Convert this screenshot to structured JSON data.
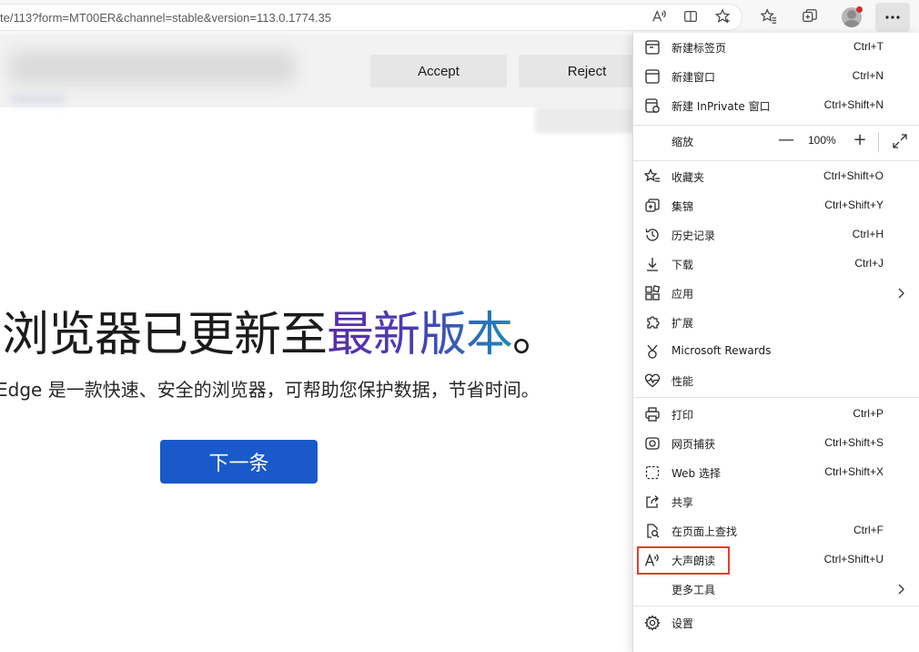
{
  "address_bar": {
    "url": "te/113?form=MT00ER&channel=stable&version=113.0.1774.35"
  },
  "cookie_banner": {
    "accept_label": "Accept",
    "reject_label": "Reject"
  },
  "page": {
    "headline_plain": "浏览器已更新至",
    "headline_highlight": "最新版本",
    "headline_end": "。",
    "subline": "Edge 是一款快速、安全的浏览器，可帮助您保护数据，节省时间。",
    "next_button": "下一条"
  },
  "menu": {
    "items": [
      {
        "label": "新建标签页",
        "shortcut": "Ctrl+T"
      },
      {
        "label": "新建窗口",
        "shortcut": "Ctrl+N"
      },
      {
        "label": "新建 InPrivate 窗口",
        "shortcut": "Ctrl+Shift+N"
      },
      {
        "label": "缩放",
        "shortcut": ""
      },
      {
        "label": "收藏夹",
        "shortcut": "Ctrl+Shift+O"
      },
      {
        "label": "集锦",
        "shortcut": "Ctrl+Shift+Y"
      },
      {
        "label": "历史记录",
        "shortcut": "Ctrl+H"
      },
      {
        "label": "下载",
        "shortcut": "Ctrl+J"
      },
      {
        "label": "应用",
        "shortcut": ""
      },
      {
        "label": "扩展",
        "shortcut": ""
      },
      {
        "label": "Microsoft Rewards",
        "shortcut": ""
      },
      {
        "label": "性能",
        "shortcut": ""
      },
      {
        "label": "打印",
        "shortcut": "Ctrl+P"
      },
      {
        "label": "网页捕获",
        "shortcut": "Ctrl+Shift+S"
      },
      {
        "label": "Web 选择",
        "shortcut": "Ctrl+Shift+X"
      },
      {
        "label": "共享",
        "shortcut": ""
      },
      {
        "label": "在页面上查找",
        "shortcut": "Ctrl+F"
      },
      {
        "label": "大声朗读",
        "shortcut": "Ctrl+Shift+U"
      },
      {
        "label": "更多工具",
        "shortcut": ""
      },
      {
        "label": "设置",
        "shortcut": ""
      }
    ],
    "zoom": {
      "minus": "—",
      "value": "100%",
      "plus": "+"
    }
  },
  "colors": {
    "accent_button": "#1a59c9",
    "highlight_box": "#e3402b",
    "notification_dot": "#d32b2b"
  }
}
